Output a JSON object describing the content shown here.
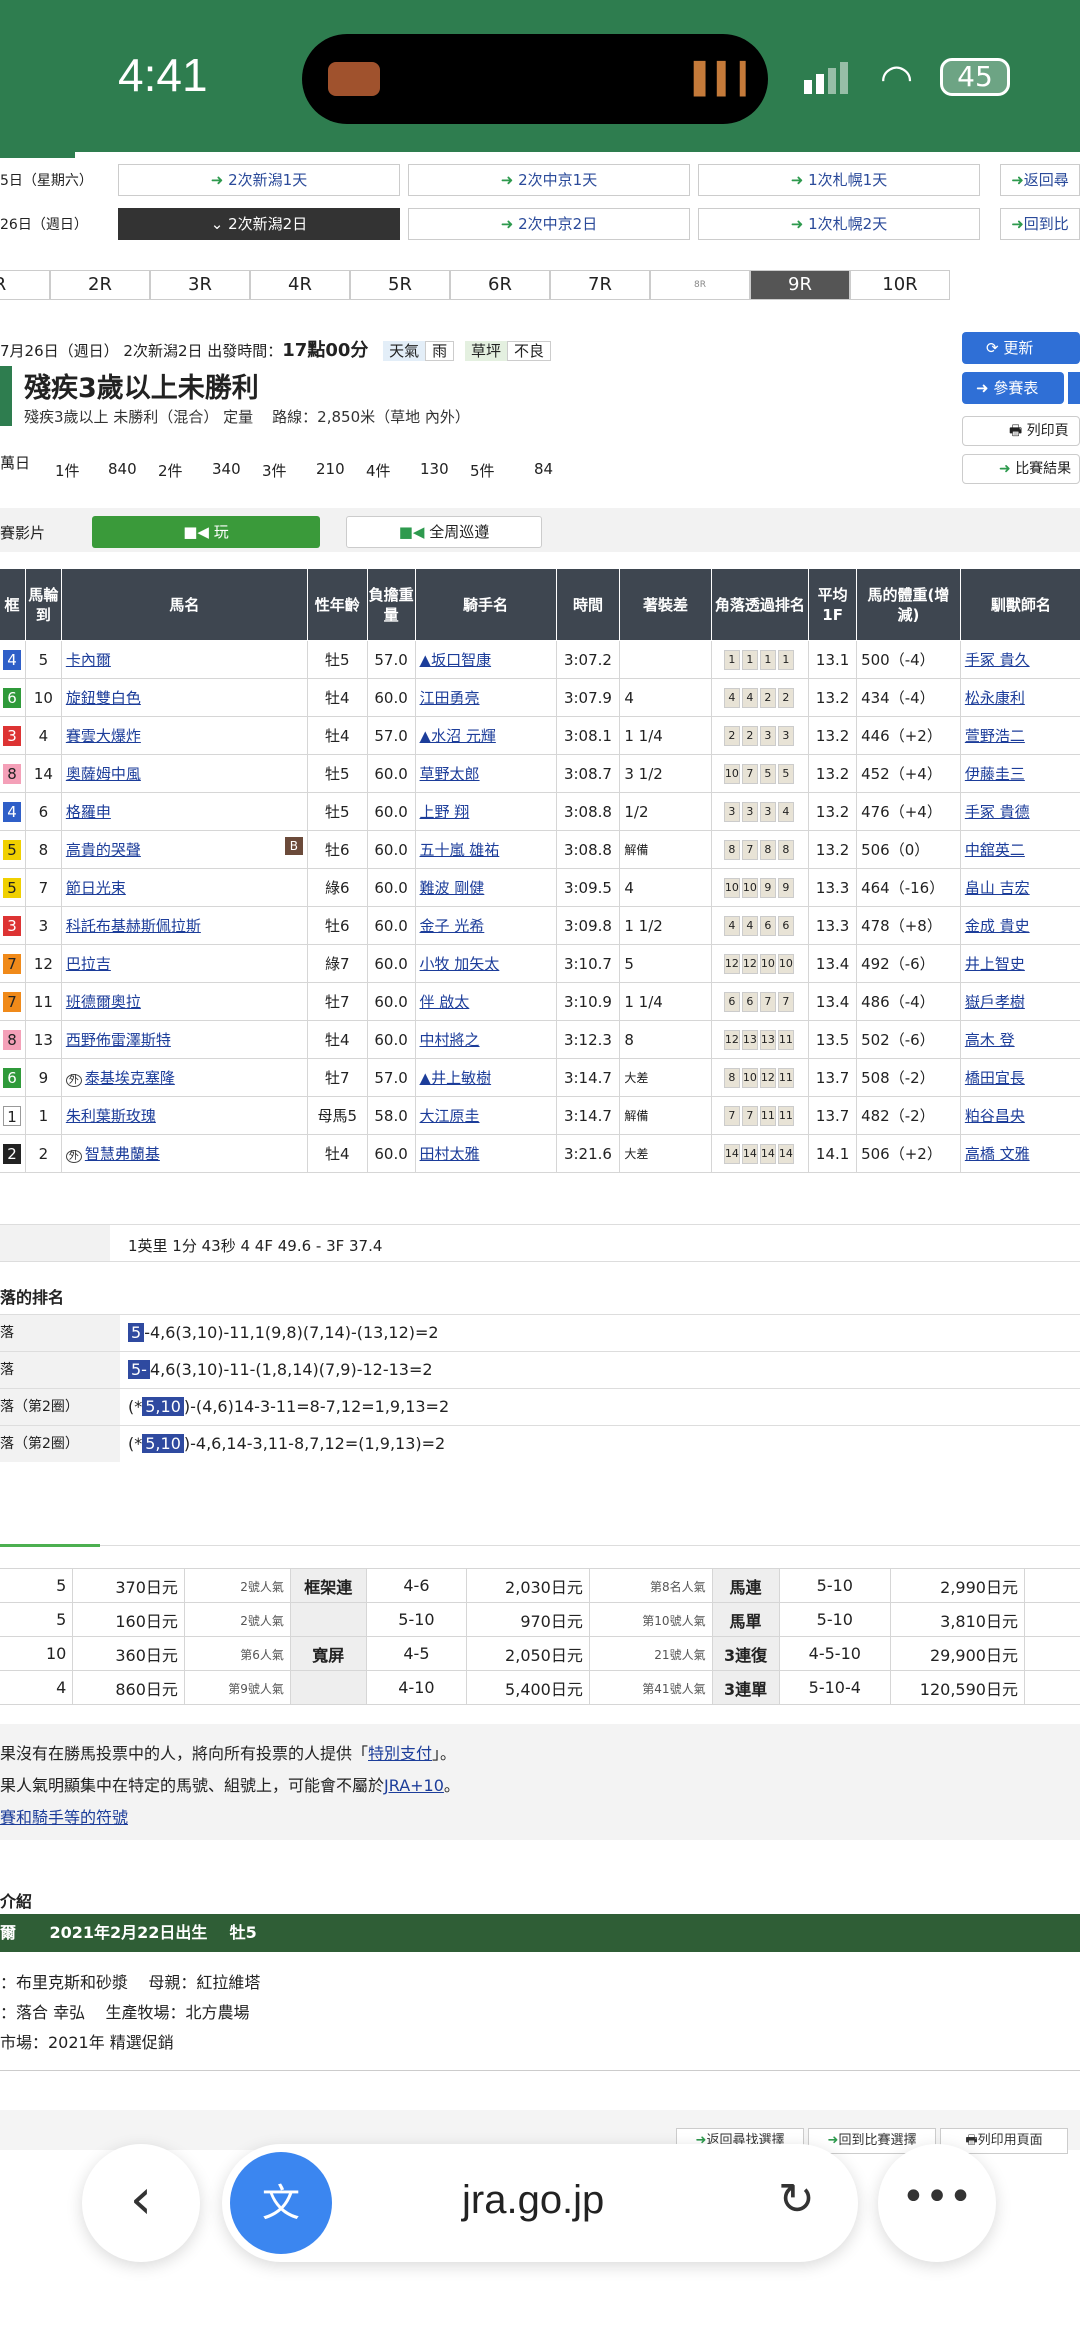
{
  "status": {
    "time": "4:41",
    "battery": "45"
  },
  "meeting_rows": [
    {
      "day": "5日（星期六）",
      "items": [
        "2次新潟1天",
        "2次中京1天",
        "1次札幌1天"
      ],
      "side": "返回尋"
    },
    {
      "day": "26日（週日）",
      "items": [
        "2次新潟2日",
        "2次中京2日",
        "1次札幌2天"
      ],
      "side": "回到比"
    }
  ],
  "races": [
    "R",
    "2R",
    "3R",
    "4R",
    "5R",
    "6R",
    "7R",
    "8R",
    "9R",
    "10R"
  ],
  "race_info": {
    "date": "7月26日（週日） 2次新潟2日 出發時間：",
    "start_time": "17點00分",
    "weather_label": "天氣",
    "weather": "雨",
    "turf_label": "草坪",
    "turf": "不良",
    "title": "殘疾3歲以上未勝利",
    "subtitle": "殘疾3歲以上 未勝利（混合） 定量",
    "course": "路線：2,850米（草地 內外）",
    "prize_prefix": "萬日",
    "prizes": [
      "1件",
      "840",
      "2件",
      "340",
      "3件",
      "210",
      "4件",
      "130",
      "5件",
      "84"
    ],
    "buttons": {
      "update": "更新",
      "ref": "參賽表",
      "print": "列印頁",
      "results": "比賽結果"
    }
  },
  "video": {
    "label": "賽影片",
    "play": "玩",
    "patrol": "全周巡遵"
  },
  "table_headers": [
    "框",
    "馬輪到",
    "馬名",
    "性年齡",
    "負擔重量",
    "騎手名",
    "時間",
    "著裝差",
    "角落透過排名",
    "平均1F",
    "馬的體重(增減)",
    "馴獸師名"
  ],
  "rows": [
    {
      "w": "4",
      "n": "5",
      "name": "卡內爾",
      "sex": "牡5",
      "wt": "57.0",
      "jockey": "▲坂口智康",
      "time": "3:07.2",
      "diff": "",
      "pos": [
        "1",
        "1",
        "1",
        "1"
      ],
      "f": "13.1",
      "bw": "500（-4）",
      "trainer": "手冢 貴久"
    },
    {
      "w": "6",
      "n": "10",
      "name": "旋鈕雙白色",
      "sex": "牡4",
      "wt": "60.0",
      "jockey": "江田勇亮",
      "time": "3:07.9",
      "diff": "4",
      "pos": [
        "4",
        "4",
        "2",
        "2"
      ],
      "f": "13.2",
      "bw": "434（-4）",
      "trainer": "松永康利"
    },
    {
      "w": "3",
      "n": "4",
      "name": "賽雲大爆炸",
      "sex": "牡4",
      "wt": "57.0",
      "jockey": "▲水沼 元輝",
      "time": "3:08.1",
      "diff": "1 1/4",
      "pos": [
        "2",
        "2",
        "3",
        "3"
      ],
      "f": "13.2",
      "bw": "446（+2）",
      "trainer": "萱野浩二"
    },
    {
      "w": "8",
      "n": "14",
      "name": "奧薩姆中風",
      "sex": "牡5",
      "wt": "60.0",
      "jockey": "草野太郎",
      "time": "3:08.7",
      "diff": "3 1/2",
      "pos": [
        "10",
        "7",
        "5",
        "5"
      ],
      "f": "13.2",
      "bw": "452（+4）",
      "trainer": "伊藤圭三"
    },
    {
      "w": "4",
      "n": "6",
      "name": "格羅申",
      "sex": "牡5",
      "wt": "60.0",
      "jockey": "上野 翔",
      "time": "3:08.8",
      "diff": "1/2",
      "pos": [
        "3",
        "3",
        "3",
        "4"
      ],
      "f": "13.2",
      "bw": "476（+4）",
      "trainer": "手冢 貴德"
    },
    {
      "w": "5",
      "n": "8",
      "name": "高貴的哭聲",
      "sex": "牡6",
      "wt": "60.0",
      "jockey": "五十嵐 雄祐",
      "time": "3:08.8",
      "diff": "解備",
      "pos": [
        "8",
        "7",
        "8",
        "8"
      ],
      "f": "13.2",
      "bw": "506（0）",
      "trainer": "中舘英二",
      "blinker": "B"
    },
    {
      "w": "5",
      "n": "7",
      "name": "節日光束",
      "sex": "綠6",
      "wt": "60.0",
      "jockey": "難波 剛健",
      "time": "3:09.5",
      "diff": "4",
      "pos": [
        "10",
        "10",
        "9",
        "9"
      ],
      "f": "13.3",
      "bw": "464（-16）",
      "trainer": "畠山 吉宏"
    },
    {
      "w": "3",
      "n": "3",
      "name": "科託布基赫斯佩拉斯",
      "sex": "牡6",
      "wt": "60.0",
      "jockey": "金子 光希",
      "time": "3:09.8",
      "diff": "1 1/2",
      "pos": [
        "4",
        "4",
        "6",
        "6"
      ],
      "f": "13.3",
      "bw": "478（+8）",
      "trainer": "金成 貴史"
    },
    {
      "w": "7",
      "n": "12",
      "name": "巴拉吉",
      "sex": "綠7",
      "wt": "60.0",
      "jockey": "小牧 加矢太",
      "time": "3:10.7",
      "diff": "5",
      "pos": [
        "12",
        "12",
        "10",
        "10"
      ],
      "f": "13.4",
      "bw": "492（-6）",
      "trainer": "井上智史"
    },
    {
      "w": "7",
      "n": "11",
      "name": "班德爾奧拉",
      "sex": "牡7",
      "wt": "60.0",
      "jockey": "伴 啟太",
      "time": "3:10.9",
      "diff": "1 1/4",
      "pos": [
        "6",
        "6",
        "7",
        "7"
      ],
      "f": "13.4",
      "bw": "486（-4）",
      "trainer": "嶽戶孝樹"
    },
    {
      "w": "8",
      "n": "13",
      "name": "西野佈雷澤斯特",
      "sex": "牡4",
      "wt": "60.0",
      "jockey": "中村將之",
      "time": "3:12.3",
      "diff": "8",
      "pos": [
        "12",
        "13",
        "13",
        "11"
      ],
      "f": "13.5",
      "bw": "502（-6）",
      "trainer": "高木 登"
    },
    {
      "w": "6",
      "n": "9",
      "name": "泰基埃克塞隆",
      "sex": "牡7",
      "wt": "57.0",
      "jockey": "▲井上敏樹",
      "time": "3:14.7",
      "diff": "大差",
      "pos": [
        "8",
        "10",
        "12",
        "11"
      ],
      "f": "13.7",
      "bw": "508（-2）",
      "trainer": "橋田宜長",
      "maru": "外"
    },
    {
      "w": "1",
      "n": "1",
      "name": "朱利葉斯玫瑰",
      "sex": "母馬5",
      "wt": "58.0",
      "jockey": "大江原圭",
      "time": "3:14.7",
      "diff": "解備",
      "pos": [
        "7",
        "7",
        "11",
        "11"
      ],
      "f": "13.7",
      "bw": "482（-2）",
      "trainer": "粕谷昌央"
    },
    {
      "w": "2",
      "n": "2",
      "name": "智慧弗蘭基",
      "sex": "牡4",
      "wt": "60.0",
      "jockey": "田村太雅",
      "time": "3:21.6",
      "diff": "大差",
      "pos": [
        "14",
        "14",
        "14",
        "14"
      ],
      "f": "14.1",
      "bw": "506（+2）",
      "trainer": "高橋 文雅",
      "maru": "外"
    }
  ],
  "summary_line": "1英里 1分 43秒 4 4F 49.6 - 3F 37.4",
  "corner": {
    "title": "落的排名",
    "rows": [
      {
        "label": "落",
        "lead": "5",
        "text": "-4,6(3,10)-11,1(9,8)(7,14)-(13,12)=2"
      },
      {
        "label": "落",
        "lead": "5-",
        "text": "4,6(3,10)-11-(1,8,14)(7,9)-12-13=2"
      },
      {
        "label": "落（第2圈）",
        "pre": "(*",
        "lead": "5,10",
        "text": ")-(4,6)14-3-11=8-7,12=1,9,13=2"
      },
      {
        "label": "落（第2圈）",
        "pre": "(*",
        "lead": "5,10",
        "text": ")-4,6,14-3,11-8,7,12=(1,9,13)=2"
      }
    ]
  },
  "payout": [
    [
      "5",
      "370日元",
      "2號人氣",
      "框架連",
      "4-6",
      "2,030日元",
      "第8名人氣",
      "馬連",
      "5-10",
      "2,990日元"
    ],
    [
      "5",
      "160日元",
      "2號人氣",
      "",
      "5-10",
      "970日元",
      "第10號人氣",
      "馬單",
      "5-10",
      "3,810日元"
    ],
    [
      "10",
      "360日元",
      "第6人氣",
      "寬屏",
      "4-5",
      "2,050日元",
      "21號人氣",
      "3連復",
      "4-5-10",
      "29,900日元"
    ],
    [
      "4",
      "860日元",
      "第9號人氣",
      "",
      "4-10",
      "5,400日元",
      "第41號人氣",
      "3連單",
      "5-10-4",
      "120,590日元"
    ]
  ],
  "notes": {
    "line1": "果沒有在勝馬投票中的人，將向所有投票的人提供「",
    "link1": "特別支付",
    "line1b": "」。",
    "line2": "果人氣明顯集中在特定的馬號、組號上，可能會不屬於",
    "link2": "JRA+10",
    "line2b": "。",
    "link3": "賽和騎手等的符號"
  },
  "intro": {
    "title": "介紹",
    "bar_left": "爾",
    "birth": "2021年2月22日出生",
    "sex": "牡5",
    "sire": "布里克斯和砂漿",
    "dam": "母親：紅拉維塔",
    "owner": "落合 幸弘",
    "breeder": "生產牧場：北方農場",
    "market": "市場：2021年 精選促銷"
  },
  "bottom_buttons": [
    "返回尋找選擇",
    "回到比賽選擇",
    "列印用頁面"
  ],
  "browser": {
    "url": "jra.go.jp"
  }
}
